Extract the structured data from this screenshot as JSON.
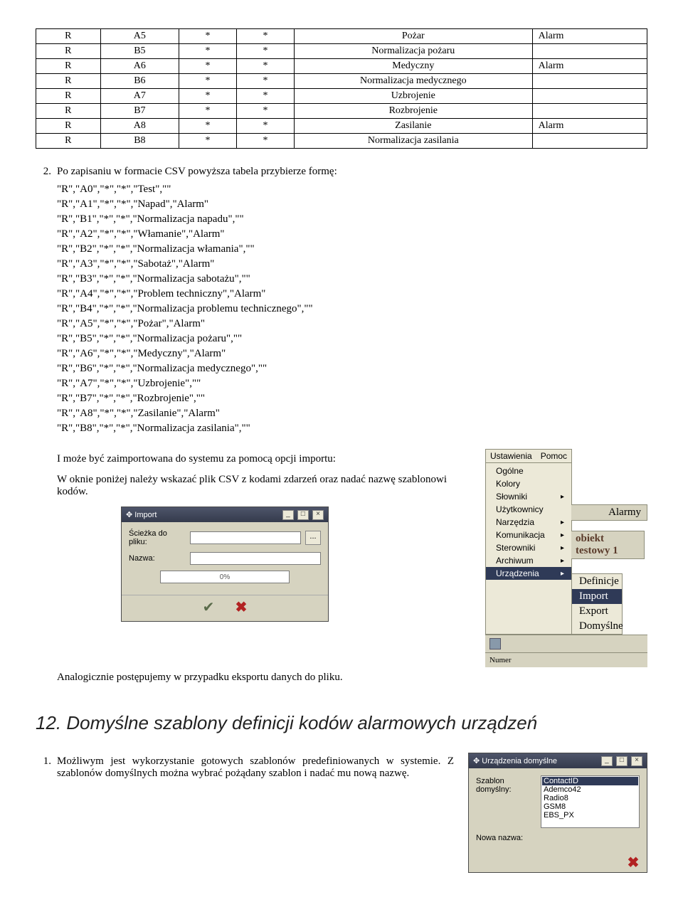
{
  "table": {
    "rows": [
      {
        "c1": "R",
        "c2": "A5",
        "c3": "*",
        "c4": "*",
        "c5": "Pożar",
        "c6": "Alarm"
      },
      {
        "c1": "R",
        "c2": "B5",
        "c3": "*",
        "c4": "*",
        "c5": "Normalizacja pożaru",
        "c6": ""
      },
      {
        "c1": "R",
        "c2": "A6",
        "c3": "*",
        "c4": "*",
        "c5": "Medyczny",
        "c6": "Alarm"
      },
      {
        "c1": "R",
        "c2": "B6",
        "c3": "*",
        "c4": "*",
        "c5": "Normalizacja medycznego",
        "c6": ""
      },
      {
        "c1": "R",
        "c2": "A7",
        "c3": "*",
        "c4": "*",
        "c5": "Uzbrojenie",
        "c6": ""
      },
      {
        "c1": "R",
        "c2": "B7",
        "c3": "*",
        "c4": "*",
        "c5": "Rozbrojenie",
        "c6": ""
      },
      {
        "c1": "R",
        "c2": "A8",
        "c3": "*",
        "c4": "*",
        "c5": "Zasilanie",
        "c6": "Alarm"
      },
      {
        "c1": "R",
        "c2": "B8",
        "c3": "*",
        "c4": "*",
        "c5": "Normalizacja zasilania",
        "c6": ""
      }
    ]
  },
  "step2": {
    "num": "2.",
    "text": "Po zapisaniu w formacie CSV powyższa tabela przybierze formę:"
  },
  "csv": "\"R\",\"A0\",\"*\",\"*\",\"Test\",\"\"\n\"R\",\"A1\",\"*\",\"*\",\"Napad\",\"Alarm\"\n\"R\",\"B1\",\"*\",\"*\",\"Normalizacja napadu\",\"\"\n\"R\",\"A2\",\"*\",\"*\",\"Włamanie\",\"Alarm\"\n\"R\",\"B2\",\"*\",\"*\",\"Normalizacja włamania\",\"\"\n\"R\",\"A3\",\"*\",\"*\",\"Sabotaż\",\"Alarm\"\n\"R\",\"B3\",\"*\",\"*\",\"Normalizacja sabotażu\",\"\"\n\"R\",\"A4\",\"*\",\"*\",\"Problem techniczny\",\"Alarm\"\n\"R\",\"B4\",\"*\",\"*\",\"Normalizacja problemu technicznego\",\"\"\n\"R\",\"A5\",\"*\",\"*\",\"Pożar\",\"Alarm\"\n\"R\",\"B5\",\"*\",\"*\",\"Normalizacja pożaru\",\"\"\n\"R\",\"A6\",\"*\",\"*\",\"Medyczny\",\"Alarm\"\n\"R\",\"B6\",\"*\",\"*\",\"Normalizacja medycznego\",\"\"\n\"R\",\"A7\",\"*\",\"*\",\"Uzbrojenie\",\"\"\n\"R\",\"B7\",\"*\",\"*\",\"Rozbrojenie\",\"\"\n\"R\",\"A8\",\"*\",\"*\",\"Zasilanie\",\"Alarm\"\n\"R\",\"B8\",\"*\",\"*\",\"Normalizacja zasilania\",\"\"",
  "para1": "I może być zaimportowana do systemu za pomocą opcji importu:",
  "para2": "W oknie poniżej należy wskazać plik CSV z kodami zdarzeń oraz nadać nazwę szablonowi kodów.",
  "menu": {
    "header": [
      "Ustawienia",
      "Pomoc"
    ],
    "items": [
      "Ogólne",
      "Kolory",
      "Słowniki",
      "Użytkownicy",
      "Narzędzia",
      "Komunikacja",
      "Sterowniki",
      "Archiwum",
      "Urządzenia"
    ],
    "side_label1": "Alarmy",
    "side_label2": "obiekt testowy 1",
    "submenu": [
      "Definicje",
      "Import",
      "Export",
      "Domyślne"
    ],
    "under_icon_label": "",
    "numer_label": "Numer"
  },
  "import_dialog": {
    "title": "Import",
    "path_label": "Ścieżka do pliku:",
    "name_label": "Nazwa:",
    "progress": "0%",
    "browse": "...",
    "win_min": "_",
    "win_max": "□",
    "win_close": "×"
  },
  "para3": "Analogicznie postępujemy w przypadku eksportu danych do pliku.",
  "heading": "12. Domyślne szablony definicji kodów alarmowych urządzeń",
  "step12_1": {
    "num": "1.",
    "text": "Możliwym jest wykorzystanie gotowych szablonów predefiniowanych w systemie. Z szablonów domyślnych można wybrać pożądany szablon i nadać mu nową nazwę."
  },
  "default_dialog": {
    "title": "Urządzenia domyślne",
    "label1": "Szablon domyślny:",
    "label2": "Nowa nazwa:",
    "options": [
      "ContactID",
      "Ademco42",
      "Radio8",
      "GSM8",
      "EBS_PX"
    ],
    "win_min": "_",
    "win_max": "□",
    "win_close": "×"
  }
}
